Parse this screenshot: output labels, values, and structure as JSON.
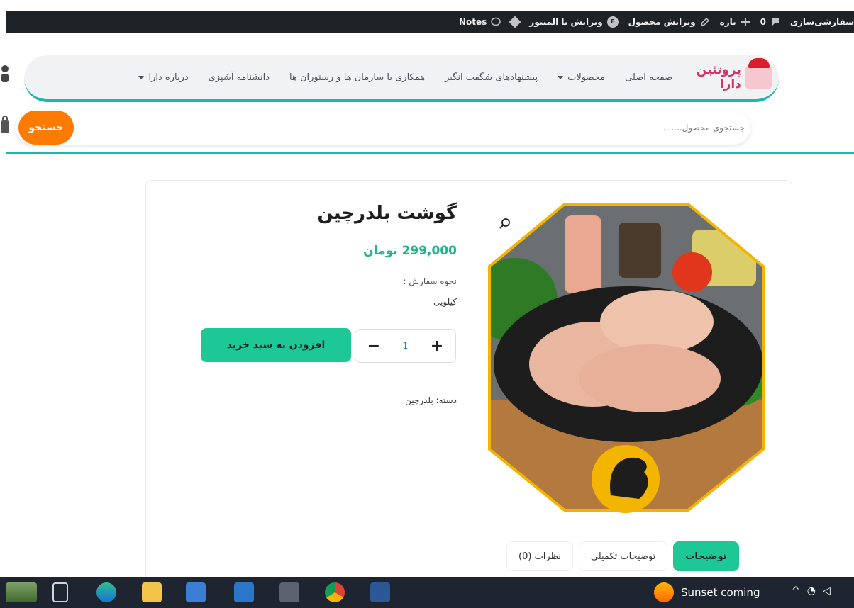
{
  "adminbar": {
    "customize": "سفارشی‌سازی",
    "comments_count": "0",
    "new": "تازه",
    "edit_product": "ویرایش محصول",
    "edit_elementor": "ویرایش با المنتور",
    "notes": "Notes"
  },
  "nav": {
    "items": [
      {
        "label": "صفحه اصلی",
        "caret": false
      },
      {
        "label": "محصولات",
        "caret": true
      },
      {
        "label": "پیشنهادهای شگفت انگیز",
        "caret": false
      },
      {
        "label": "همکاری با سازمان ها و رستوران ها",
        "caret": false
      },
      {
        "label": "دانشنامه آشپزی",
        "caret": false
      },
      {
        "label": "درباره دارا",
        "caret": true
      }
    ],
    "logo_text": "پروتئین دارا"
  },
  "search": {
    "placeholder": "جستجوی محصول.......",
    "button": "جستجو"
  },
  "product": {
    "title": "گوشت بلدرچین",
    "price": "299,000 تومان",
    "order_label": "نحوه سفارش :",
    "order_value": "کیلویی",
    "quantity": "1",
    "add_to_cart": "افزودن به سبد خرید",
    "category": "دسته: بلدرچین"
  },
  "tabs": [
    "توضیحات",
    "توضیحات تکمیلی",
    "نظرات (0)"
  ],
  "taskbar": {
    "weather": "Sunset coming",
    "icons": [
      "start-icon",
      "task-view-icon",
      "edge-icon",
      "file-explorer-icon",
      "store-icon",
      "mail-icon",
      "camera-icon",
      "chrome-icon",
      "word-icon"
    ]
  },
  "colors": {
    "accent_teal": "#1db5ac",
    "cart_green": "#1ec896",
    "search_orange": "#ff7a00",
    "price_green": "#20b58a",
    "hex_border": "#f3b500"
  }
}
